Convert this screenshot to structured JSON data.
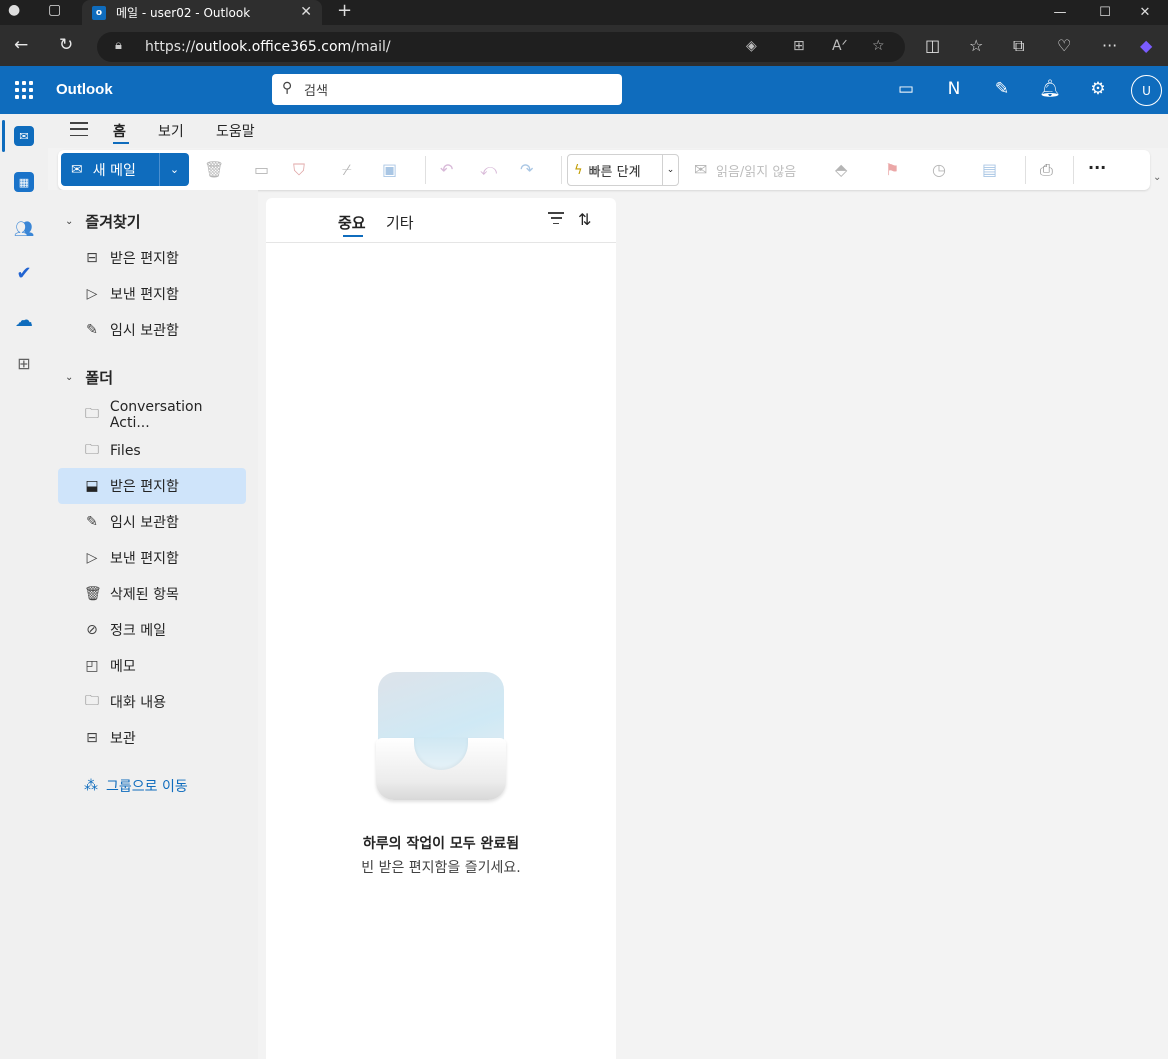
{
  "browser": {
    "tab_title": "메일 - user02 - Outlook",
    "url_prefix": "https://",
    "url_host": "outlook.office365.com",
    "url_path": "/mail/"
  },
  "outlook": {
    "brand": "Outlook",
    "search_placeholder": "검색",
    "avatar_initial": "U",
    "accent_color": "#0f6cbd"
  },
  "ribbon": {
    "tabs": [
      "홈",
      "보기",
      "도움말"
    ],
    "active_tab": "홈",
    "new_mail": "새 메일",
    "quick_steps": "빠른 단계",
    "read_unread": "읽음/읽지 않음",
    "more": "···"
  },
  "folder_pane": {
    "favorites_header": "즐겨찾기",
    "favorites": [
      {
        "label": "받은 편지함",
        "icon": "inbox-icon"
      },
      {
        "label": "보낸 편지함",
        "icon": "send-icon"
      },
      {
        "label": "임시 보관함",
        "icon": "draft-icon"
      }
    ],
    "folders_header": "폴더",
    "folders": [
      {
        "label": "Conversation Acti...",
        "icon": "folder-icon"
      },
      {
        "label": "Files",
        "icon": "folder-icon"
      },
      {
        "label": "받은 편지함",
        "icon": "inbox-icon",
        "selected": true
      },
      {
        "label": "임시 보관함",
        "icon": "draft-icon"
      },
      {
        "label": "보낸 편지함",
        "icon": "send-icon"
      },
      {
        "label": "삭제된 항목",
        "icon": "trash-icon"
      },
      {
        "label": "정크 메일",
        "icon": "junk-icon"
      },
      {
        "label": "메모",
        "icon": "note-icon"
      },
      {
        "label": "대화 내용",
        "icon": "folder-icon"
      },
      {
        "label": "보관",
        "icon": "archive-icon"
      }
    ],
    "go_to_groups": "그룹으로 이동"
  },
  "message_list": {
    "tab_focused": "중요",
    "tab_other": "기타",
    "empty_title": "하루의 작업이 모두 완료됨",
    "empty_subtitle": "빈 받은 편지함을 즐기세요."
  }
}
